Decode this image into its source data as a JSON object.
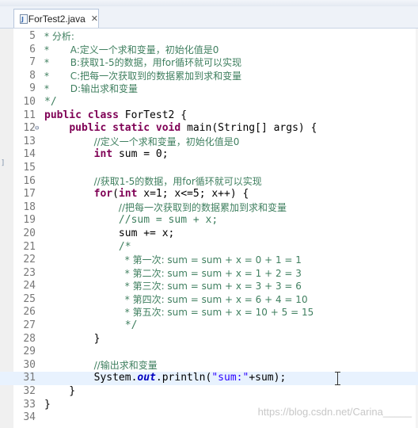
{
  "editor": {
    "tab": {
      "title": "ForTest2.java",
      "close_symbol": "✕",
      "icon": "java-file-icon"
    },
    "watermark": "https://blog.csdn.net/Carina_____",
    "lines": [
      {
        "n": "5",
        "s": [
          [
            "cm",
            "* 分析:"
          ]
        ]
      },
      {
        "n": "6",
        "s": [
          [
            "cm",
            "*       A:定义一个求和变量，初始化值是0"
          ]
        ]
      },
      {
        "n": "7",
        "s": [
          [
            "cm",
            "*       B:获取1-5的数据，用for循环就可以实现"
          ]
        ]
      },
      {
        "n": "8",
        "s": [
          [
            "cm",
            "*       C:把每一次获取到的数据累加到求和变量"
          ]
        ]
      },
      {
        "n": "9",
        "s": [
          [
            "cm",
            "*       D:输出求和变量"
          ]
        ]
      },
      {
        "n": "10",
        "s": [
          [
            "cm",
            "*/"
          ]
        ]
      },
      {
        "n": "11",
        "s": [
          [
            "kw",
            "public class "
          ],
          [
            "",
            "ForTest2 {"
          ]
        ]
      },
      {
        "n": "12",
        "fold": true,
        "s": [
          [
            "",
            "    "
          ],
          [
            "kw",
            "public static void "
          ],
          [
            "",
            "main(String[] args) {"
          ]
        ]
      },
      {
        "n": "13",
        "s": [
          [
            "",
            "        "
          ],
          [
            "cm",
            "//定义一个求和变量，初始化值是0"
          ]
        ]
      },
      {
        "n": "14",
        "s": [
          [
            "",
            "        "
          ],
          [
            "kw",
            "int "
          ],
          [
            "",
            "sum = 0;"
          ]
        ]
      },
      {
        "n": "15",
        "s": []
      },
      {
        "n": "16",
        "s": [
          [
            "",
            "        "
          ],
          [
            "cm",
            "//获取1-5的数据，用for循环就可以实现"
          ]
        ]
      },
      {
        "n": "17",
        "s": [
          [
            "",
            "        "
          ],
          [
            "kw",
            "for"
          ],
          [
            "",
            "("
          ],
          [
            "kw",
            "int "
          ],
          [
            "",
            "x=1; x<=5; x++) {"
          ]
        ]
      },
      {
        "n": "18",
        "s": [
          [
            "",
            "            "
          ],
          [
            "cm",
            "//把每一次获取到的数据累加到求和变量"
          ]
        ]
      },
      {
        "n": "19",
        "s": [
          [
            "",
            "            "
          ],
          [
            "cm",
            "//sum = sum + x;"
          ]
        ]
      },
      {
        "n": "20",
        "s": [
          [
            "",
            "            sum += x;"
          ]
        ]
      },
      {
        "n": "21",
        "s": [
          [
            "",
            "            "
          ],
          [
            "cm",
            "/*"
          ]
        ]
      },
      {
        "n": "22",
        "s": [
          [
            "",
            "             "
          ],
          [
            "cm",
            "* 第一次: sum = sum + x = 0 + 1 = 1"
          ]
        ]
      },
      {
        "n": "23",
        "s": [
          [
            "",
            "             "
          ],
          [
            "cm",
            "* 第二次: sum = sum + x = 1 + 2 = 3"
          ]
        ]
      },
      {
        "n": "24",
        "s": [
          [
            "",
            "             "
          ],
          [
            "cm",
            "* 第三次: sum = sum + x = 3 + 3 = 6"
          ]
        ]
      },
      {
        "n": "25",
        "s": [
          [
            "",
            "             "
          ],
          [
            "cm",
            "* 第四次: sum = sum + x = 6 + 4 = 10"
          ]
        ]
      },
      {
        "n": "26",
        "s": [
          [
            "",
            "             "
          ],
          [
            "cm",
            "* 第五次: sum = sum + x = 10 + 5 = 15"
          ]
        ]
      },
      {
        "n": "27",
        "s": [
          [
            "",
            "             "
          ],
          [
            "cm",
            "*/"
          ]
        ]
      },
      {
        "n": "28",
        "s": [
          [
            "",
            "        }"
          ]
        ]
      },
      {
        "n": "29",
        "s": []
      },
      {
        "n": "30",
        "s": [
          [
            "",
            "        "
          ],
          [
            "cm",
            "//输出求和变量"
          ]
        ]
      },
      {
        "n": "31",
        "current": true,
        "s": [
          [
            "",
            "        System."
          ],
          [
            "fld",
            "out"
          ],
          [
            "",
            ".println("
          ],
          [
            "st",
            "\"sum:\""
          ],
          [
            "",
            "+sum);"
          ]
        ]
      },
      {
        "n": "32",
        "s": [
          [
            "",
            "    }"
          ]
        ]
      },
      {
        "n": "33",
        "s": [
          [
            "",
            "}"
          ]
        ]
      },
      {
        "n": "34",
        "s": []
      }
    ]
  }
}
